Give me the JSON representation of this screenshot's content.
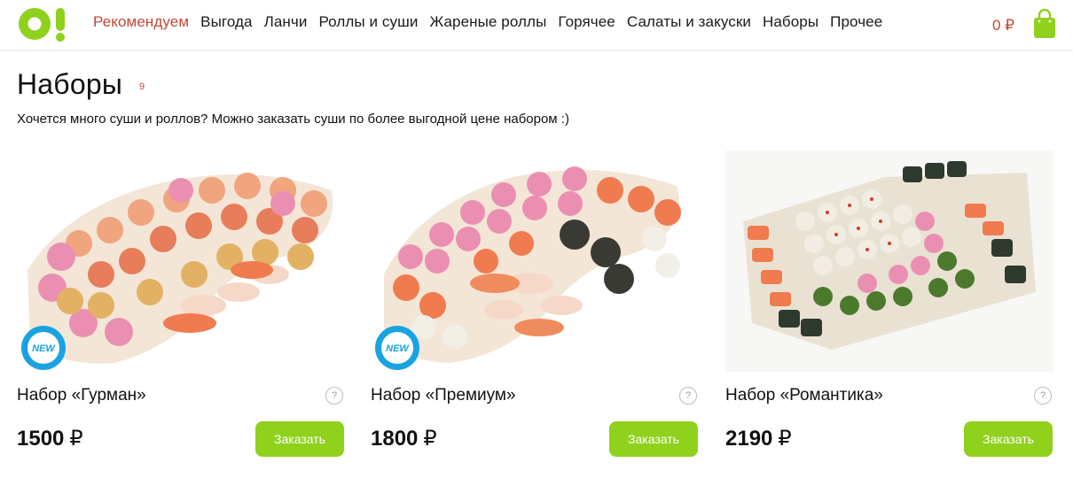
{
  "header": {
    "nav": [
      {
        "label": "Рекомендуем",
        "active": true
      },
      {
        "label": "Выгода"
      },
      {
        "label": "Ланчи"
      },
      {
        "label": "Роллы и суши"
      },
      {
        "label": "Жареные роллы"
      },
      {
        "label": "Горячее"
      },
      {
        "label": "Салаты и закуски"
      },
      {
        "label": "Наборы"
      },
      {
        "label": "Прочее"
      }
    ],
    "cart_total": "0 ₽",
    "logo_icon": "logo-icon",
    "cart_icon": "shopping-bag-icon"
  },
  "page": {
    "title": "Наборы",
    "count": "9",
    "subtitle": "Хочется много суши и роллов? Можно заказать суши по более выгодной цене набором :)"
  },
  "products": [
    {
      "name": "Набор «Гурман»",
      "price": "1500",
      "currency": "₽",
      "button": "Заказать",
      "badge": "NEW",
      "help": "?"
    },
    {
      "name": "Набор «Премиум»",
      "price": "1800",
      "currency": "₽",
      "button": "Заказать",
      "badge": "NEW",
      "help": "?"
    },
    {
      "name": "Набор «Романтика»",
      "price": "2190",
      "currency": "₽",
      "button": "Заказать",
      "help": "?"
    }
  ],
  "colors": {
    "accent_green": "#8fd11d",
    "active_red": "#c0493a",
    "badge_blue": "#1aa3e0"
  }
}
